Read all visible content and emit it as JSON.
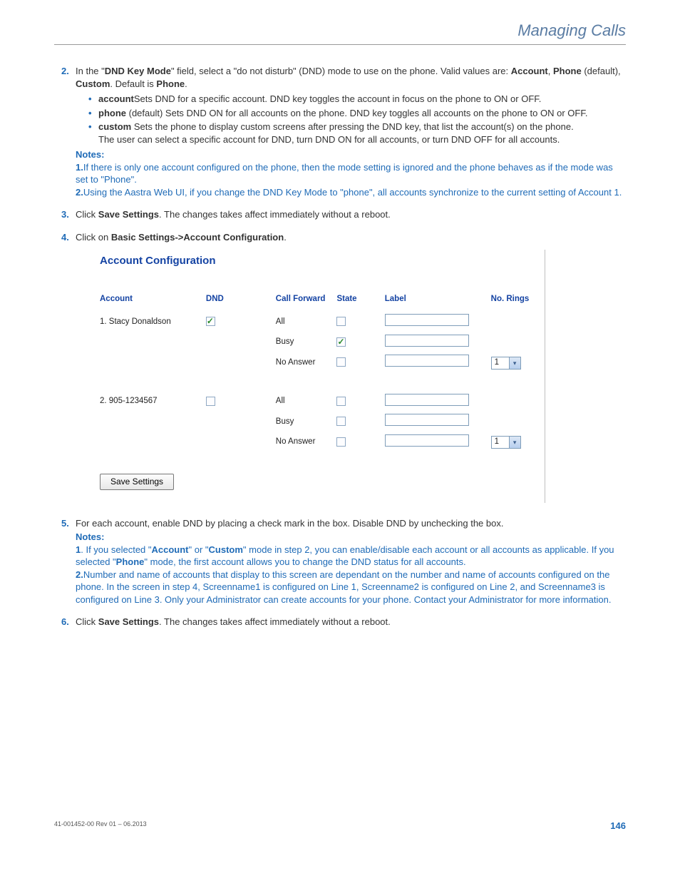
{
  "header": {
    "title": "Managing Calls"
  },
  "step2": {
    "num": "2.",
    "text_a": "In the \"",
    "bold_a": "DND Key Mode",
    "text_b": "\" field, select a \"do not disturb\" (DND) mode to use on the phone. Valid values are: ",
    "bold_b": "Account",
    "text_c": ", ",
    "bold_c": "Phone",
    "text_d": " (default), ",
    "bold_d": "Custom",
    "text_e": ". Default is ",
    "bold_e": "Phone",
    "text_f": ".",
    "bullets": {
      "b1_bold": "account",
      "b1_text": "Sets DND for a specific account. DND key toggles the account in focus on the phone to ON or OFF.",
      "b2_bold": "phone",
      "b2_text": " (default) Sets DND ON for all accounts on the phone. DND key toggles all accounts on the phone to ON or OFF.",
      "b3_bold": "custom",
      "b3_text": " Sets the phone to display custom screens after pressing the DND key, that list the account(s) on the phone.",
      "b3_extra": "The user can select a specific account for DND, turn DND ON for all accounts, or turn DND OFF for all accounts."
    },
    "notes": {
      "title": "Notes:",
      "n1_num": "1.",
      "n1_text": "If there is only one account configured on the phone, then the mode setting is ignored and the phone behaves as if the mode was set to \"Phone\".",
      "n2_num": "2.",
      "n2_text": "Using the Aastra Web UI, if you change the DND Key Mode to \"phone\", all accounts synchronize to the current setting of Account 1."
    }
  },
  "step3": {
    "num": "3.",
    "text_a": "Click ",
    "bold_a": "Save Settings",
    "text_b": ". The changes takes affect immediately without a reboot."
  },
  "step4": {
    "num": "4.",
    "text_a": "Click on ",
    "bold_a": "Basic Settings->Account Configuration",
    "text_b": "."
  },
  "embed": {
    "title": "Account Configuration",
    "headers": {
      "account": "Account",
      "dnd": "DND",
      "call_forward": "Call Forward",
      "state": "State",
      "label": "Label",
      "no_rings": "No. Rings"
    },
    "row1": {
      "account": "1. Stacy Donaldson",
      "dnd_checked": true,
      "cf_all": "All",
      "cf_all_checked": false,
      "cf_busy": "Busy",
      "cf_busy_checked": true,
      "cf_na": "No Answer",
      "cf_na_checked": false,
      "rings": "1"
    },
    "row2": {
      "account": "2. 905-1234567",
      "dnd_checked": false,
      "cf_all": "All",
      "cf_all_checked": false,
      "cf_busy": "Busy",
      "cf_busy_checked": false,
      "cf_na": "No Answer",
      "cf_na_checked": false,
      "rings": "1"
    },
    "save_button": "Save Settings"
  },
  "step5": {
    "num": "5.",
    "text": "For each account, enable DND by placing a check mark in the box. Disable DND by unchecking the box.",
    "notes": {
      "title": "Notes:",
      "n1_num": "1",
      "n1_a": ". If you selected \"",
      "n1_bold_a": "Account",
      "n1_b": "\" or \"",
      "n1_bold_b": "Custom",
      "n1_c": "\" mode in step 2, you can enable/disable each account or all accounts as applicable. If you selected \"",
      "n1_bold_c": "Phone",
      "n1_d": "\" mode, the first account allows you to change the DND status for all accounts.",
      "n2_num": "2.",
      "n2_text": "Number and name of accounts that display to this screen are dependant on the number and name of accounts configured on the phone. In the screen in step 4, Screenname1 is configured on Line 1, Screenname2 is configured on Line 2, and Screenname3 is configured on Line 3. Only your Administrator can create accounts for your phone. Contact your Administrator for more information."
    }
  },
  "step6": {
    "num": "6.",
    "text_a": "Click ",
    "bold_a": "Save Settings",
    "text_b": ". The changes takes affect immediately without a reboot."
  },
  "footer": {
    "rev": "41-001452-00 Rev 01 – 06.2013",
    "page": "146"
  }
}
